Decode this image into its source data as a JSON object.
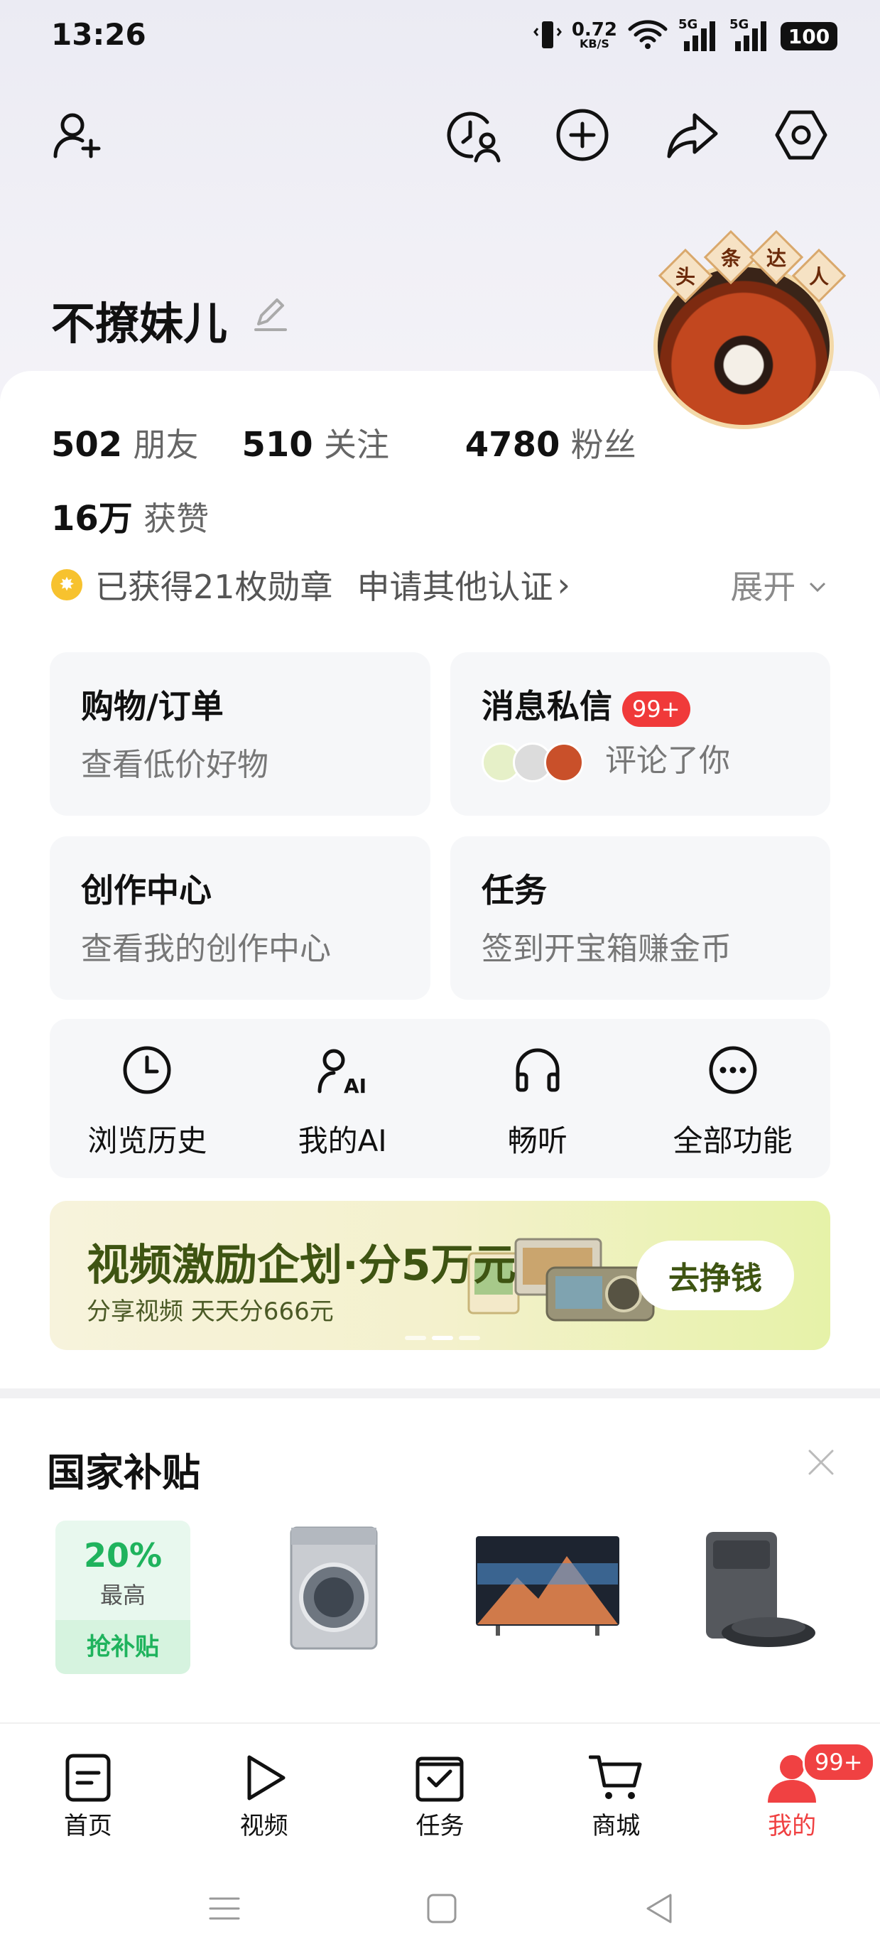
{
  "status_bar": {
    "time": "13:26",
    "speed_value": "0.72",
    "speed_unit": "KB/S",
    "net1": "5G",
    "net2": "5G",
    "battery": "100"
  },
  "header": {
    "icons": [
      "add-friend-icon",
      "history-user-icon",
      "plus-circle-icon",
      "share-icon",
      "settings-hexagon-icon"
    ]
  },
  "profile": {
    "name": "不撩妹儿",
    "badge_chars": [
      "头",
      "条",
      "达",
      "人"
    ]
  },
  "stats": {
    "friends_count": "502",
    "friends_label": "朋友",
    "following_count": "510",
    "following_label": "关注",
    "fans_count": "4780",
    "fans_label": "粉丝",
    "likes_count": "16万",
    "likes_label": "获赞"
  },
  "medals": {
    "text": "已获得21枚勋章",
    "apply": "申请其他认证",
    "chevron": "›",
    "expand": "展开"
  },
  "tiles": {
    "shopping": {
      "title": "购物/订单",
      "sub": "查看低价好物"
    },
    "messages": {
      "title": "消息私信",
      "badge": "99+",
      "sub": "评论了你"
    },
    "creation": {
      "title": "创作中心",
      "sub": "查看我的创作中心"
    },
    "tasks": {
      "title": "任务",
      "sub": "签到开宝箱赚金币"
    }
  },
  "quick": [
    {
      "label": "浏览历史",
      "icon": "clock-icon"
    },
    {
      "label": "我的AI",
      "icon": "ai-user-icon"
    },
    {
      "label": "畅听",
      "icon": "headphones-icon"
    },
    {
      "label": "全部功能",
      "icon": "more-dots-icon"
    }
  ],
  "banner": {
    "title": "视频激励企划·分5万元",
    "subtitle": "分享视频 天天分666元",
    "button": "去挣钱"
  },
  "subsidy": {
    "title": "国家补贴",
    "percent": "20%",
    "max_label": "最高",
    "grab": "抢补贴",
    "products": [
      "washing-machine",
      "television",
      "robot-vacuum"
    ]
  },
  "nav": {
    "items": [
      {
        "label": "首页",
        "icon": "home-doc-icon"
      },
      {
        "label": "视频",
        "icon": "play-icon"
      },
      {
        "label": "任务",
        "icon": "task-check-icon"
      },
      {
        "label": "商城",
        "icon": "cart-icon"
      },
      {
        "label": "我的",
        "icon": "person-icon"
      }
    ],
    "badge": "99+"
  },
  "colors": {
    "accent_red": "#f04142",
    "banner_green": "#3e5412",
    "subsidy_green": "#1fb35d"
  }
}
